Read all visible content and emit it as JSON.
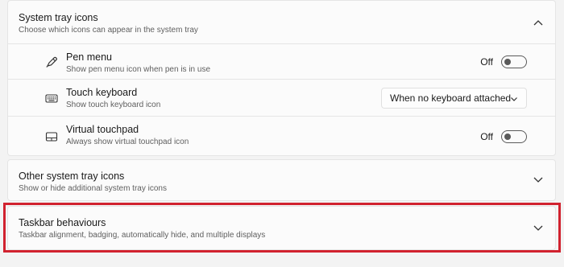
{
  "system_tray": {
    "title": "System tray icons",
    "description": "Choose which icons can appear in the system tray",
    "expand_icon": "chevron-up-icon",
    "items": [
      {
        "title": "Pen menu",
        "description": "Show pen menu icon when pen is in use",
        "icon": "pen-icon",
        "control": "toggle",
        "state_label": "Off"
      },
      {
        "title": "Touch keyboard",
        "description": "Show touch keyboard icon",
        "icon": "keyboard-icon",
        "control": "dropdown",
        "selected": "When no keyboard attached"
      },
      {
        "title": "Virtual touchpad",
        "description": "Always show virtual touchpad icon",
        "icon": "touchpad-icon",
        "control": "toggle",
        "state_label": "Off"
      }
    ]
  },
  "other_tray": {
    "title": "Other system tray icons",
    "description": "Show or hide additional system tray icons",
    "expand_icon": "chevron-down-icon"
  },
  "taskbar_behaviours": {
    "title": "Taskbar behaviours",
    "description": "Taskbar alignment, badging, automatically hide, and multiple displays",
    "expand_icon": "chevron-down-icon"
  },
  "colors": {
    "highlight_border": "#d1222f",
    "card_background": "#fbfbfb",
    "page_background": "#f3f3f3"
  }
}
